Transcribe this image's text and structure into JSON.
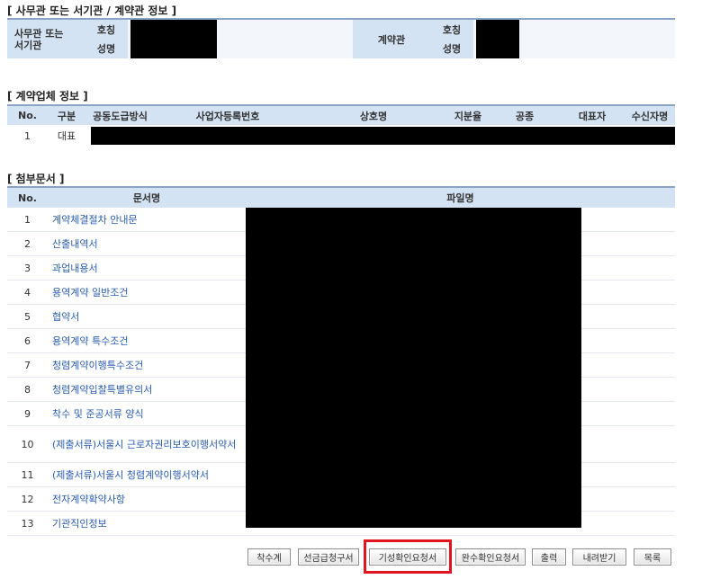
{
  "contract_section": {
    "title": "[ 사무관 또는 서기관 / 계약관 정보 ]",
    "officer_label": "사무관 또는\n서기관",
    "title_label": "호칭",
    "name_label": "성명",
    "contractor_label": "계약관",
    "contractor_title_label": "호칭",
    "contractor_name_label": "성명"
  },
  "company_section": {
    "title": "[ 계약업체 정보 ]",
    "headers": [
      "No.",
      "구분",
      "공동도급방식",
      "사업자등록번호",
      "상호명",
      "지분율",
      "공종",
      "대표자",
      "수신자명"
    ],
    "rows": [
      {
        "no": "1",
        "type": "대표"
      }
    ]
  },
  "attachments_section": {
    "title": "[ 첨부문서 ]",
    "headers": [
      "No.",
      "문서명",
      "파일명"
    ],
    "rows": [
      {
        "no": "1",
        "name": "계약체결절차 안내문"
      },
      {
        "no": "2",
        "name": "산출내역서"
      },
      {
        "no": "3",
        "name": "과업내용서"
      },
      {
        "no": "4",
        "name": "용역계약 일반조건"
      },
      {
        "no": "5",
        "name": "협약서"
      },
      {
        "no": "6",
        "name": "용역계약 특수조건"
      },
      {
        "no": "7",
        "name": "청렴계약이행특수조건"
      },
      {
        "no": "8",
        "name": "청렴계약입찰특별유의서"
      },
      {
        "no": "9",
        "name": "착수 및 준공서류 양식"
      },
      {
        "no": "10",
        "name": "(제출서류)서울시 근로자권리보호이행서약서"
      },
      {
        "no": "11",
        "name": "(제출서류)서울시 청렴계약이행서약서"
      },
      {
        "no": "12",
        "name": "전자계약확약사항"
      },
      {
        "no": "13",
        "name": "기관직인정보"
      }
    ]
  },
  "buttons": {
    "start_report": "착수계",
    "advance_payment": "선금급청구서",
    "progress_confirm": "기성확인요청서",
    "completion_confirm": "완수확인요청서",
    "print": "출력",
    "download": "내려받기",
    "list": "목록"
  },
  "colors": {
    "header_bg": "#d4e3f4",
    "row_bg": "#eef3fa",
    "link": "#2a5db0",
    "highlight": "#e0141e"
  }
}
